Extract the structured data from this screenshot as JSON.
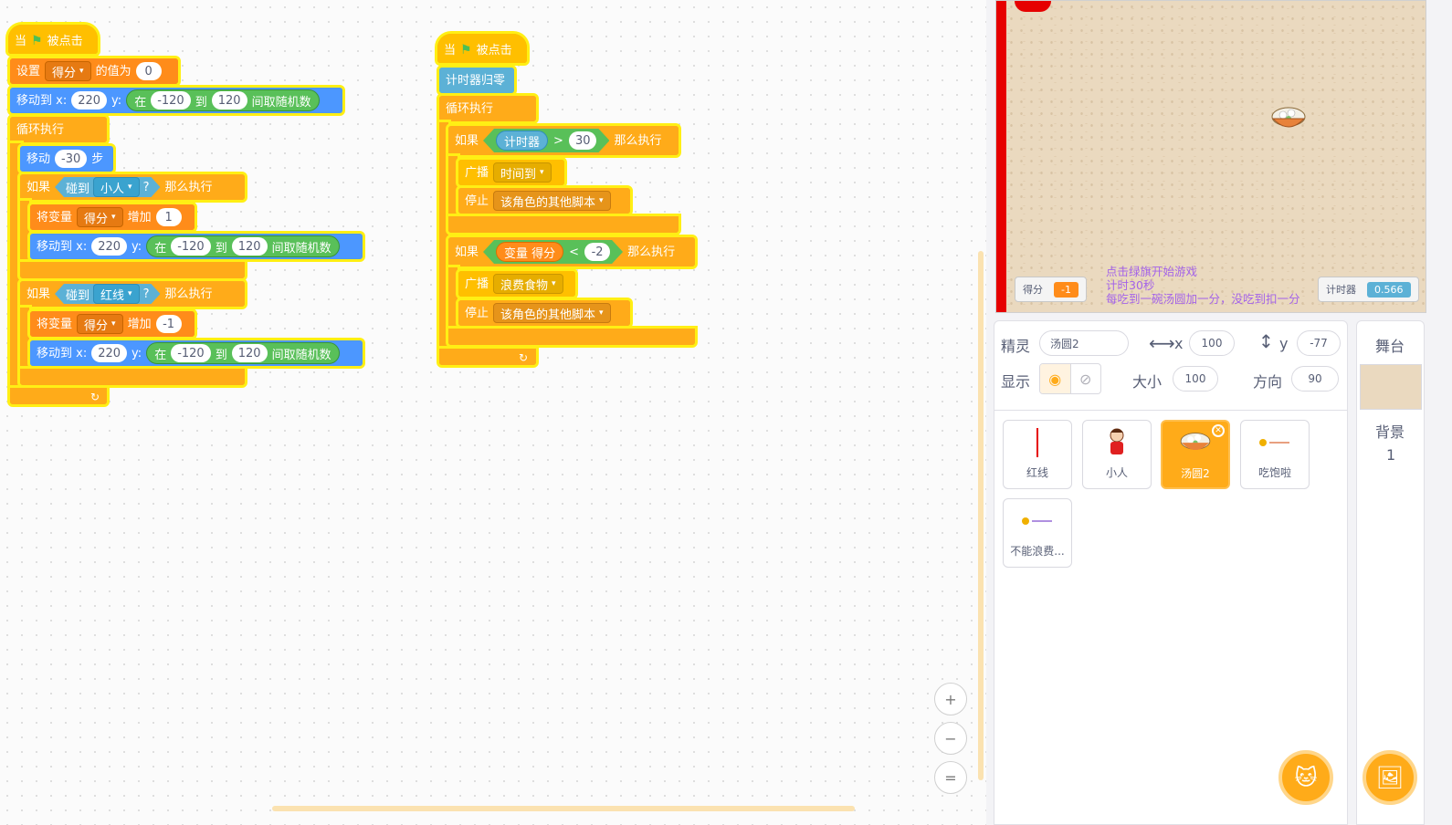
{
  "script1": {
    "hat": {
      "when": "当",
      "clicked": "被点击"
    },
    "set": {
      "label": "设置",
      "var": "得分",
      "to": "的值为",
      "value": "0"
    },
    "goto1": {
      "label": "移动到 x:",
      "x": "220",
      "y": "y:",
      "in": "在",
      "from": "-120",
      "to": "到",
      "max": "120",
      "rand": "间取随机数"
    },
    "forever": "循环执行",
    "move": {
      "label": "移动",
      "steps": "-30",
      "unit": "步"
    },
    "if1": {
      "if": "如果",
      "touch": "碰到",
      "target": "小人",
      "q": "?",
      "then": "那么执行",
      "change": {
        "label": "将变量",
        "var": "得分",
        "inc": "增加",
        "value": "1"
      },
      "goto": {
        "label": "移动到 x:",
        "x": "220",
        "y": "y:",
        "in": "在",
        "from": "-120",
        "to": "到",
        "max": "120",
        "rand": "间取随机数"
      }
    },
    "if2": {
      "if": "如果",
      "touch": "碰到",
      "target": "红线",
      "q": "?",
      "then": "那么执行",
      "change": {
        "label": "将变量",
        "var": "得分",
        "inc": "增加",
        "value": "-1"
      },
      "goto": {
        "label": "移动到 x:",
        "x": "220",
        "y": "y:",
        "in": "在",
        "from": "-120",
        "to": "到",
        "max": "120",
        "rand": "间取随机数"
      }
    }
  },
  "script2": {
    "hat": {
      "when": "当",
      "clicked": "被点击"
    },
    "reset": "计时器归零",
    "forever": "循环执行",
    "if1": {
      "if": "如果",
      "timer": "计时器",
      "op": ">",
      "value": "30",
      "then": "那么执行",
      "broadcast": {
        "label": "广播",
        "msg": "时间到"
      },
      "stop": {
        "label": "停止",
        "opt": "该角色的其他脚本"
      }
    },
    "if2": {
      "if": "如果",
      "var": "变量 得分",
      "op": "<",
      "value": "-2",
      "then": "那么执行",
      "broadcast": {
        "label": "广播",
        "msg": "浪费食物"
      },
      "stop": {
        "label": "停止",
        "opt": "该角色的其他脚本"
      }
    }
  },
  "zoom": {
    "in": "+",
    "out": "−",
    "reset": "="
  },
  "stage": {
    "score_label": "得分",
    "score_value": "-1",
    "timer_label": "计时器",
    "timer_value": "0.566",
    "text": [
      "点击绿旗开始游戏",
      "计时30秒",
      "每吃到一碗汤圆加一分，没吃到扣一分"
    ]
  },
  "sprite_info": {
    "sprite_label": "精灵",
    "sprite_name": "汤圆2",
    "x_label": "x",
    "x": "100",
    "y_label": "y",
    "y": "-77",
    "show_label": "显示",
    "size_label": "大小",
    "size": "100",
    "direction_label": "方向",
    "direction": "90"
  },
  "sprites": [
    {
      "name": "红线"
    },
    {
      "name": "小人"
    },
    {
      "name": "汤圆2"
    },
    {
      "name": "吃饱啦"
    },
    {
      "name": "不能浪费..."
    }
  ],
  "stage_panel": {
    "title": "舞台",
    "backdrop_label": "背景",
    "backdrop_count": "1"
  },
  "colors": {
    "events": "#ffbf00",
    "control": "#ffab19",
    "motion": "#4c97ff",
    "variables": "#ff8c1a",
    "sensing": "#5cb1d6",
    "operators": "#59c059"
  }
}
